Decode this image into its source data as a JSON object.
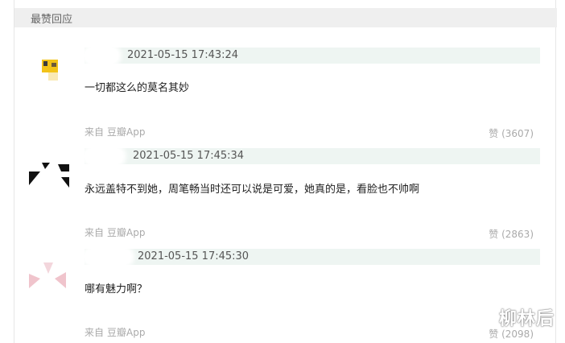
{
  "section": {
    "title": "最赞回应"
  },
  "comments": [
    {
      "timestamp": "2021-05-15 17:43:24",
      "text": "一切都这么的莫名其妙",
      "source_prefix": "来自",
      "source_app": "豆瓣App",
      "likes": "赞 (3607)"
    },
    {
      "timestamp": "2021-05-15 17:45:34",
      "text": "永远盖特不到她，周笔畅当时还可以说是可爱，她真的是，看脸也不帅啊",
      "source_prefix": "来自",
      "source_app": "豆瓣App",
      "likes": "赞 (2863)"
    },
    {
      "timestamp": "2021-05-15 17:45:30",
      "text": "哪有魅力啊？",
      "source_prefix": "来自",
      "source_app": "豆瓣App",
      "likes": "赞 (2098)"
    }
  ],
  "watermark": "柳林后",
  "colors": {
    "header_bg": "#efefef",
    "meta_bar_bg": "#eef5f2",
    "muted_text": "#aaaaaa",
    "body_text": "#222222"
  }
}
